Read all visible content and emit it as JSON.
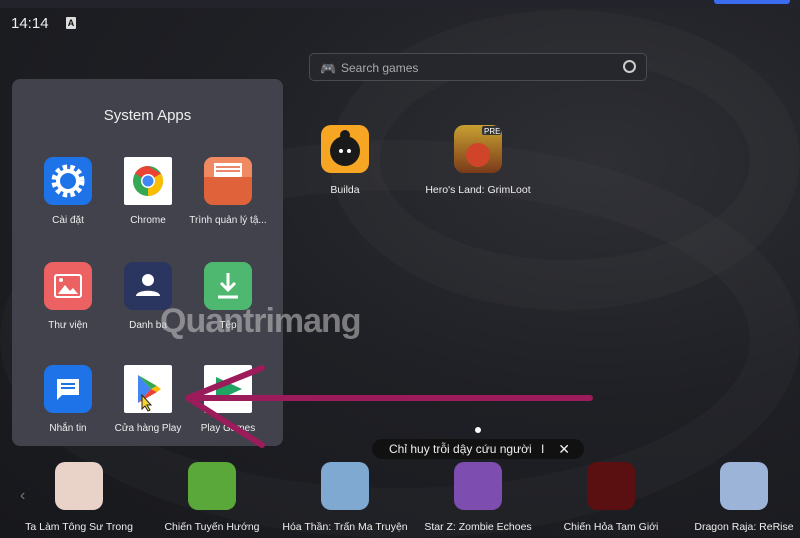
{
  "status": {
    "time": "14:14",
    "keyboard_indicator": "A"
  },
  "search": {
    "placeholder": "Search games"
  },
  "folder": {
    "title": "System Apps",
    "apps": [
      {
        "label": "Cài đặt",
        "icon": "settings-icon"
      },
      {
        "label": "Chrome",
        "icon": "chrome-icon"
      },
      {
        "label": "Trình quản lý tậ...",
        "icon": "file-manager-icon"
      },
      {
        "label": "Thư viện",
        "icon": "gallery-icon"
      },
      {
        "label": "Danh bạ",
        "icon": "contacts-icon"
      },
      {
        "label": "Tệp",
        "icon": "download-icon"
      },
      {
        "label": "Nhắn tin",
        "icon": "messages-icon"
      },
      {
        "label": "Cửa hàng Play",
        "icon": "play-store-icon"
      },
      {
        "label": "Play Games",
        "icon": "play-games-icon"
      }
    ]
  },
  "desktop": [
    {
      "label": "Builda"
    },
    {
      "label": "Hero's Land: GrimLoot",
      "badge": "PRE"
    }
  ],
  "banner": {
    "text": "Chỉ huy trỗi dậy cứu người",
    "divider": "I",
    "close": "✕"
  },
  "games": [
    {
      "label": "Ta Làm Tông Sư Trong",
      "color": "#e9d2c8"
    },
    {
      "label": "Chiến Tuyến Hướng",
      "color": "#5aa83a"
    },
    {
      "label": "Hóa Thần: Trấn Ma Truyện",
      "color": "#7fa9d0"
    },
    {
      "label": "Star Z: Zombie Echoes",
      "color": "#7d4db0"
    },
    {
      "label": "Chiến Hỏa Tam Giới",
      "color": "#5a0f10"
    },
    {
      "label": "Dragon Raja: ReRise",
      "color": "#9cb4d8"
    }
  ],
  "watermark": "Quantrimang",
  "colors": {
    "accent": "#9c1b5a"
  }
}
